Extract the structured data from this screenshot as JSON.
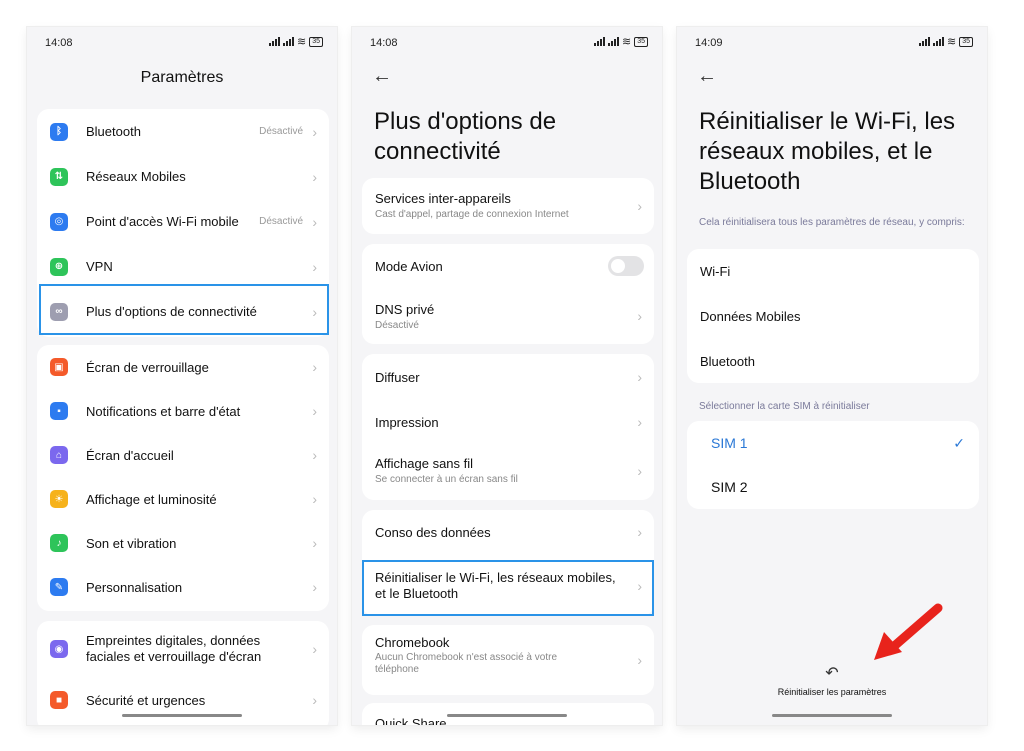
{
  "screen1": {
    "time": "14:08",
    "battery": "35",
    "title": "Paramètres",
    "group1": [
      {
        "label": "Bluetooth",
        "value": "Désactivé",
        "icon": "bluetooth-icon",
        "color": "#2d7bf0"
      },
      {
        "label": "Réseaux Mobiles",
        "value": "",
        "icon": "mobile-data-icon",
        "color": "#2ec45a"
      },
      {
        "label": "Point d'accès Wi-Fi mobile",
        "value": "Désactivé",
        "icon": "hotspot-icon",
        "color": "#2d7bf0"
      },
      {
        "label": "VPN",
        "value": "",
        "icon": "vpn-icon",
        "color": "#2ec45a"
      },
      {
        "label": "Plus d'options de connectivité",
        "value": "",
        "icon": "link-icon",
        "color": "#9e9eb0"
      }
    ],
    "group2": [
      {
        "label": "Écran de verrouillage",
        "icon": "lock-icon",
        "color": "#f45a2a"
      },
      {
        "label": "Notifications et barre d'état",
        "icon": "notification-icon",
        "color": "#2d7bf0"
      },
      {
        "label": "Écran d'accueil",
        "icon": "home-icon",
        "color": "#7b68ee"
      },
      {
        "label": "Affichage et luminosité",
        "icon": "brightness-icon",
        "color": "#f6b21b"
      },
      {
        "label": "Son et vibration",
        "icon": "sound-icon",
        "color": "#2ec45a"
      },
      {
        "label": "Personnalisation",
        "icon": "brush-icon",
        "color": "#2d7bf0"
      }
    ],
    "group3": [
      {
        "label": "Empreintes digitales, données faciales et verrouillage d'écran",
        "icon": "fingerprint-icon",
        "color": "#7b68ee"
      },
      {
        "label": "Sécurité et urgences",
        "icon": "sos-icon",
        "color": "#f45a2a"
      }
    ]
  },
  "screen2": {
    "time": "14:08",
    "battery": "35",
    "title": "Plus d'options de connectivité",
    "services": {
      "label": "Services inter-appareils",
      "sub": "Cast d'appel, partage de connexion Internet"
    },
    "mode_avion": "Mode Avion",
    "dns": {
      "label": "DNS privé",
      "sub": "Désactivé"
    },
    "diffuser": "Diffuser",
    "impression": "Impression",
    "affichage": {
      "label": "Affichage sans fil",
      "sub": "Se connecter à un écran sans fil"
    },
    "conso": "Conso des données",
    "reset": "Réinitialiser le Wi-Fi, les réseaux mobiles, et le Bluetooth",
    "chromebook": {
      "label": "Chromebook",
      "sub": "Aucun Chromebook n'est associé à votre téléphone"
    },
    "quickshare": "Quick Share"
  },
  "screen3": {
    "time": "14:09",
    "battery": "35",
    "title": "Réinitialiser le Wi-Fi, les réseaux mobiles, et le Bluetooth",
    "note": "Cela réinitialisera tous les paramètres de réseau, y compris:",
    "items": [
      "Wi-Fi",
      "Données Mobiles",
      "Bluetooth"
    ],
    "sim_label": "Sélectionner la carte SIM à réinitialiser",
    "sims": [
      "SIM 1",
      "SIM 2"
    ],
    "selected_sim": "SIM 1",
    "reset_button": "Réinitialiser les paramètres"
  },
  "colors": {
    "accent": "#2a78d6",
    "highlight": "#2a93e8",
    "arrow": "#e8231c"
  }
}
